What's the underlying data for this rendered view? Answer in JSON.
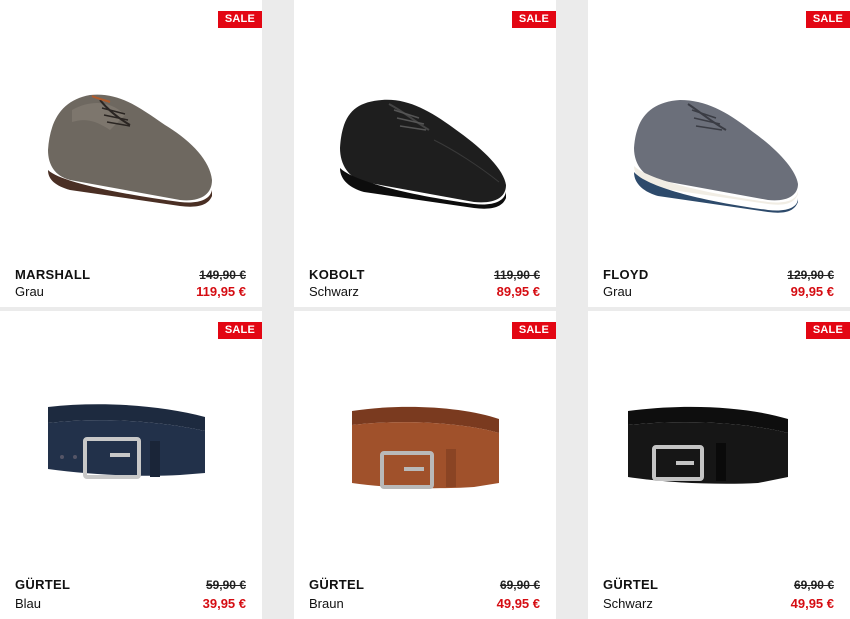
{
  "badge_label": "SALE",
  "products": [
    {
      "name": "MARSHALL",
      "color": "Grau",
      "old_price": "149,90 €",
      "new_price": "119,95 €",
      "image": "grey-derby-shoe-image"
    },
    {
      "name": "KOBOLT",
      "color": "Schwarz",
      "old_price": "119,90 €",
      "new_price": "89,95 €",
      "image": "black-derby-shoe-image"
    },
    {
      "name": "FLOYD",
      "color": "Grau",
      "old_price": "129,90 €",
      "new_price": "99,95 €",
      "image": "grey-suede-shoe-image"
    },
    {
      "name": "GÜRTEL",
      "color": "Blau",
      "old_price": "59,90 €",
      "new_price": "39,95 €",
      "image": "blue-belt-image"
    },
    {
      "name": "GÜRTEL",
      "color": "Braun",
      "old_price": "69,90 €",
      "new_price": "49,95 €",
      "image": "brown-belt-image"
    },
    {
      "name": "GÜRTEL",
      "color": "Schwarz",
      "old_price": "69,90 €",
      "new_price": "49,95 €",
      "image": "black-belt-image"
    }
  ],
  "colors": {
    "sale_red": "#e30613",
    "price_red": "#d50c12",
    "page_bg": "#ebebeb"
  }
}
